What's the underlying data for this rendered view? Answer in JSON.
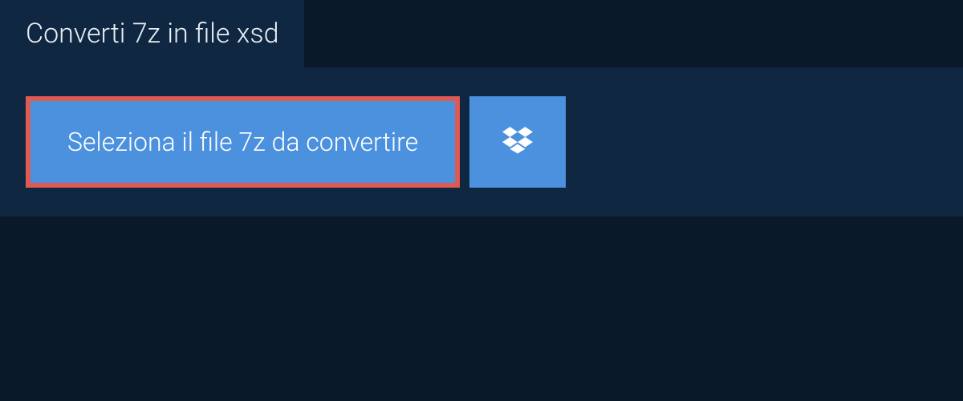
{
  "header": {
    "title": "Converti 7z in file xsd"
  },
  "actions": {
    "select_file_label": "Seleziona il file 7z da convertire",
    "cloud_icon": "dropbox-icon"
  },
  "colors": {
    "background_dark": "#0a1929",
    "panel": "#0f2741",
    "button_primary": "#4b91de",
    "button_border_highlight": "#e05a54",
    "text_light": "#ffffff"
  }
}
